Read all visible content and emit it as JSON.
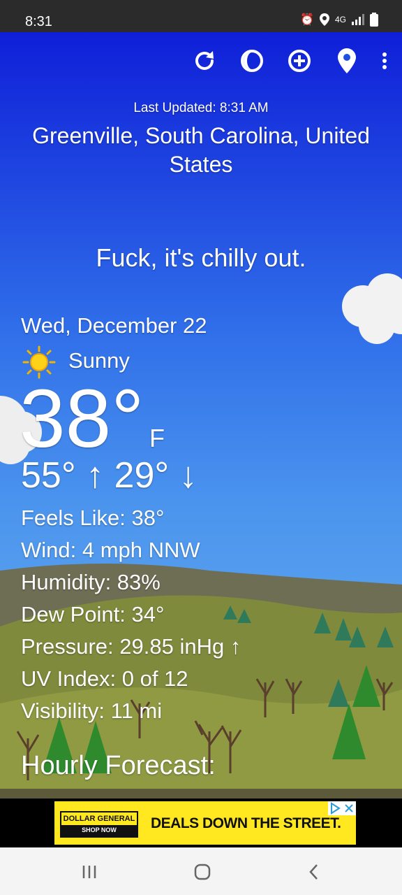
{
  "status_bar": {
    "time": "8:31",
    "network": "4G"
  },
  "toolbar": {
    "icons": [
      "refresh-icon",
      "theme-icon",
      "add-location-icon",
      "location-pin-icon",
      "more-vert-icon"
    ]
  },
  "header": {
    "last_updated": "Last Updated: 8:31 AM",
    "location": "Greenville, South Carolina, United States"
  },
  "quip": "Fuck, it's chilly out.",
  "current": {
    "date": "Wed, December 22",
    "condition": "Sunny",
    "condition_icon": "sun-icon",
    "temperature": "38°",
    "unit": "F",
    "high_low": "55° ↑ 29° ↓"
  },
  "details": {
    "feels_like": "Feels Like:  38°",
    "wind": "Wind:  4 mph NNW",
    "humidity": "Humidity:  83%",
    "dew_point": "Dew Point:  34°",
    "pressure": "Pressure:  29.85 inHg ↑",
    "uv_index": "UV Index:  0 of 12",
    "visibility": "Visibility:  11 mi"
  },
  "hourly_heading": "Hourly Forecast:",
  "ad": {
    "brand_top": "DOLLAR GENERAL",
    "brand_cta": "SHOP NOW",
    "headline": "DEALS DOWN THE STREET."
  },
  "colors": {
    "sky_top": "#0f1fd8",
    "sky_bottom": "#6fb0f0",
    "hill": "#7d8a3a",
    "ad_yellow": "#ffe81f"
  }
}
